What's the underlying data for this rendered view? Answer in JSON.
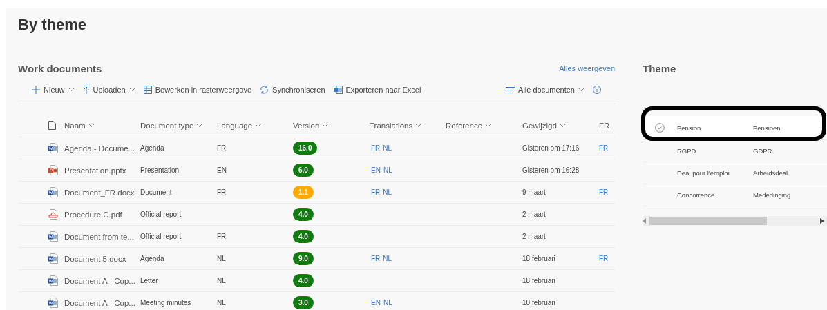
{
  "page_title": "By theme",
  "documents": {
    "title": "Work documents",
    "see_all": "Alles weergeven",
    "toolbar": [
      {
        "kind": "new",
        "label": "Nieuw",
        "dropdown": true
      },
      {
        "kind": "upload",
        "label": "Uploaden",
        "dropdown": true
      },
      {
        "kind": "grid",
        "label": "Bewerken in rasterweergave",
        "dropdown": false
      },
      {
        "kind": "sync",
        "label": "Synchroniseren",
        "dropdown": false
      },
      {
        "kind": "excel",
        "label": "Exporteren naar Excel",
        "dropdown": false
      }
    ],
    "view": "Alle documenten",
    "columns": [
      {
        "label": "Naam",
        "sortable": true
      },
      {
        "label": "Document type",
        "sortable": true
      },
      {
        "label": "Language",
        "sortable": true
      },
      {
        "label": "Version",
        "sortable": true
      },
      {
        "label": "Translations",
        "sortable": true
      },
      {
        "label": "Reference",
        "sortable": true
      },
      {
        "label": "Gewijzigd",
        "sortable": true
      },
      {
        "label": "FR",
        "sortable": false
      }
    ],
    "rows": [
      {
        "kind": "word",
        "name": "Agenda - Docume...",
        "type": "Agenda",
        "language": "FR",
        "version": {
          "label": "16.0",
          "color": "#107c10"
        },
        "translations": [
          "FR",
          "NL"
        ],
        "modified": "Gisteren om 17:16",
        "column_9": "FR"
      },
      {
        "kind": "powerpoint",
        "name": "Presentation.pptx",
        "type": "Presentation",
        "language": "EN",
        "version": {
          "label": "6.0",
          "color": "#107c10"
        },
        "translations": [
          "EN",
          "NL"
        ],
        "modified": "Gisteren om 16:28"
      },
      {
        "kind": "word",
        "name": "Document_FR.docx",
        "type": "Document",
        "language": "FR",
        "version": {
          "label": "1.1",
          "color": "#ffaa00"
        },
        "translations": [
          "FR",
          "NL"
        ],
        "modified": "9 maart",
        "column_9": "FR"
      },
      {
        "kind": "pdf",
        "name": "Procedure C.pdf",
        "type": "Official report",
        "version": {
          "label": "4.0",
          "color": "#107c10"
        },
        "modified": "2 maart"
      },
      {
        "kind": "word",
        "name": "Document from te...",
        "type": "Official report",
        "language": "FR",
        "version": {
          "label": "4.0",
          "color": "#107c10"
        },
        "modified": "2 maart"
      },
      {
        "kind": "word",
        "name": "Document 5.docx",
        "type": "Agenda",
        "language": "NL",
        "version": {
          "label": "9.0",
          "color": "#107c10"
        },
        "translations": [
          "FR",
          "NL"
        ],
        "modified": "18 februari",
        "column_9": "FR"
      },
      {
        "kind": "word",
        "name": "Document A - Cop...",
        "type": "Letter",
        "language": "NL",
        "version": {
          "label": "4.0",
          "color": "#107c10"
        },
        "modified": "18 februari"
      },
      {
        "kind": "word",
        "name": "Document A - Cop...",
        "type": "Meeting minutes",
        "language": "NL",
        "version": {
          "label": "3.0",
          "color": "#107c10"
        },
        "translations": [
          "EN",
          "NL"
        ],
        "modified": "10 februari"
      }
    ]
  },
  "theme": {
    "title": "Theme",
    "rows": [
      {
        "fr": "Pension",
        "nl": "Pensioen",
        "selected": true,
        "highlighted": true
      },
      {
        "fr": "RGPD",
        "nl": "GDPR",
        "selected": false,
        "highlighted": false
      },
      {
        "fr": "Deal pour l'emploi",
        "nl": "Arbeidsdeal",
        "selected": false,
        "highlighted": false
      },
      {
        "fr": "Concorrence",
        "nl": "Mededinging",
        "selected": false,
        "highlighted": false
      }
    ]
  }
}
